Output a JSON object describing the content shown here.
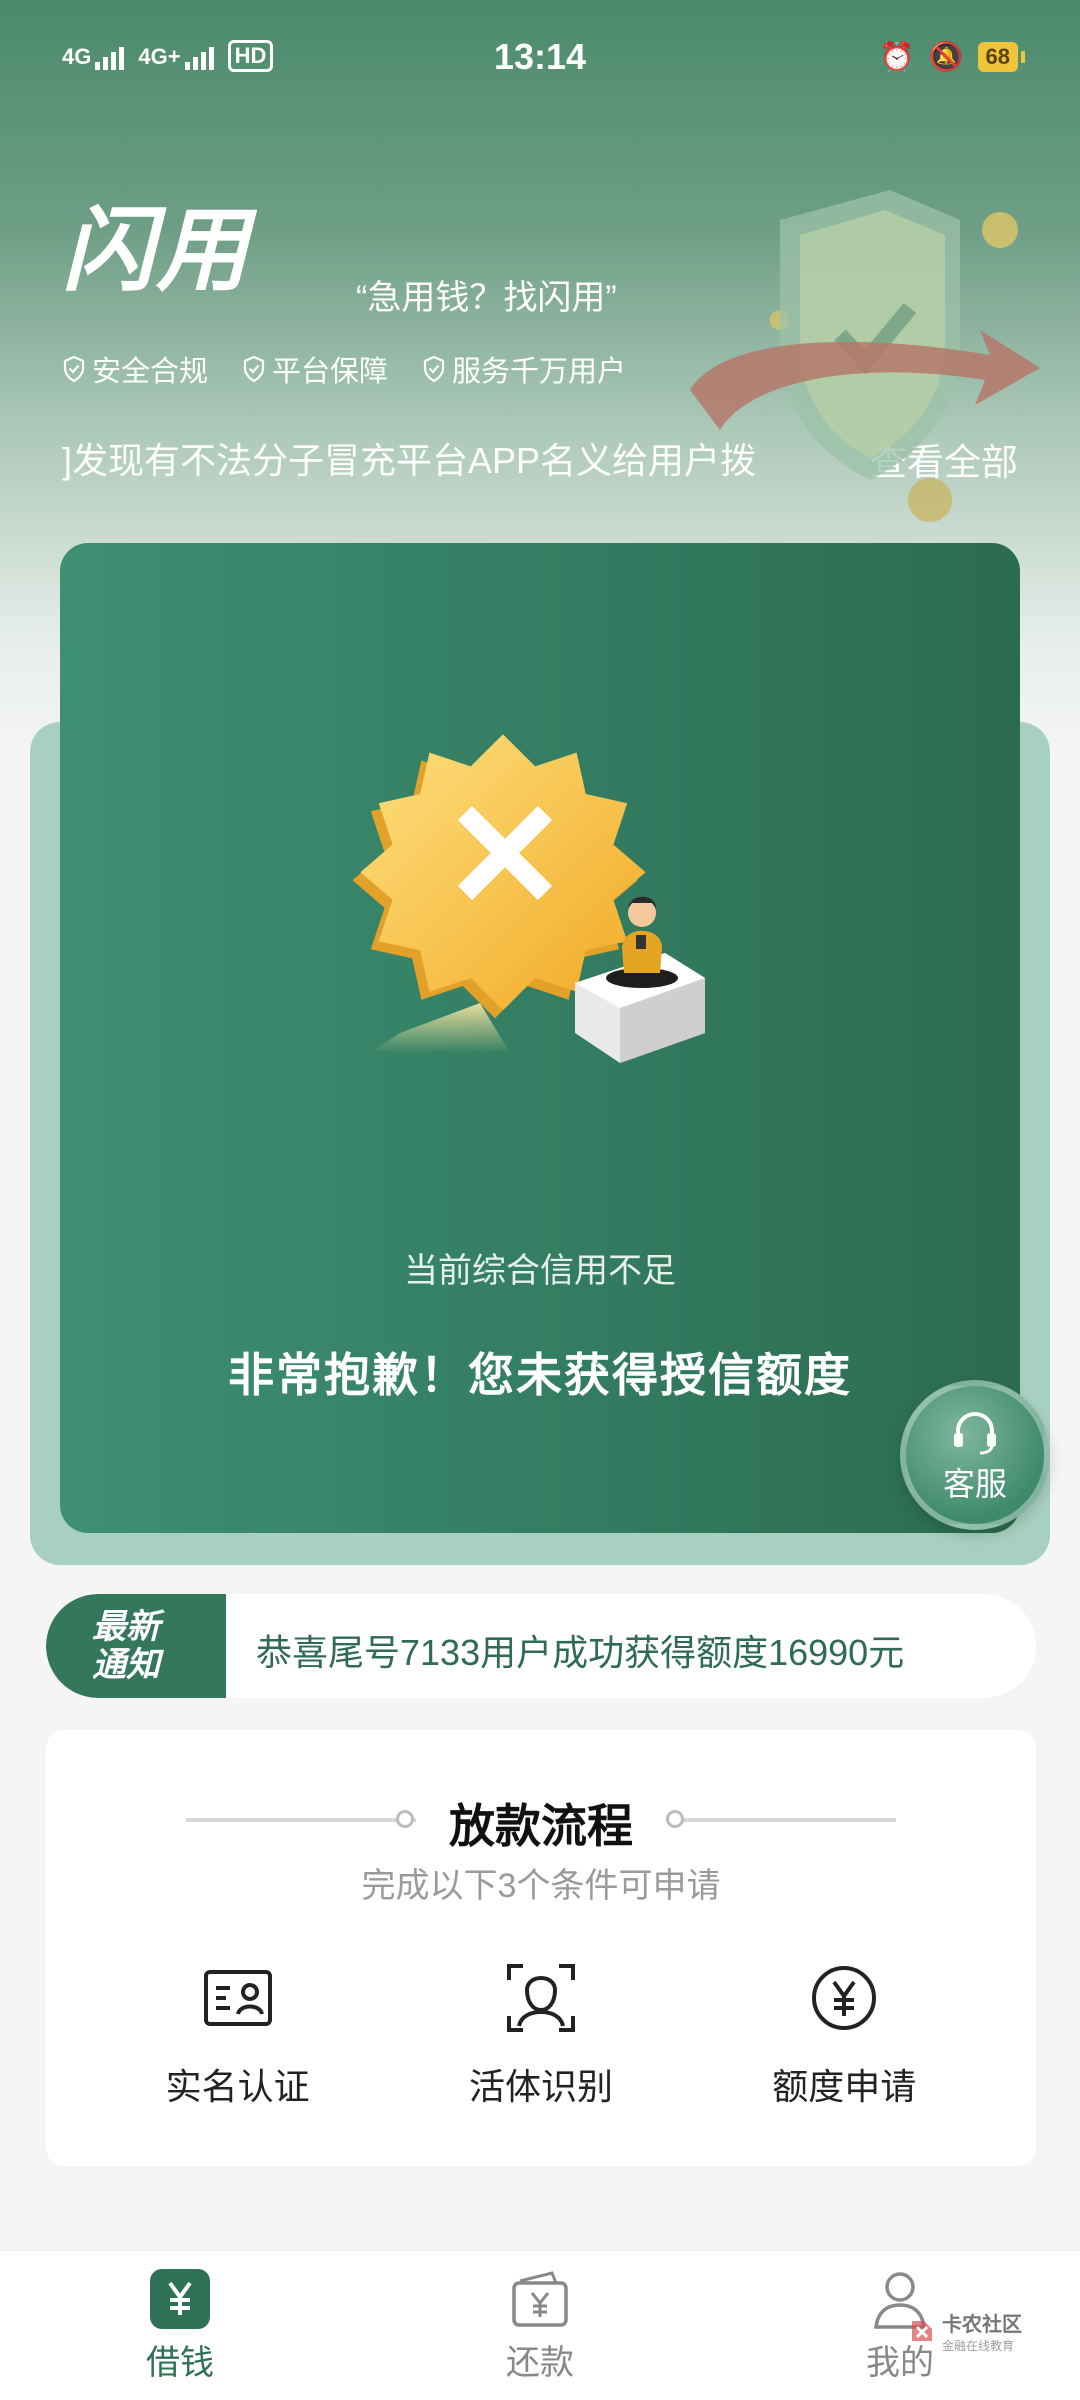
{
  "status_bar": {
    "network1": "4G",
    "network2": "4G+",
    "hd": "HD",
    "time": "13:14",
    "battery": "68"
  },
  "header": {
    "brand": "闪用",
    "slogan": "“急用钱？找闪用”",
    "badges": [
      "安全合规",
      "平台保障",
      "服务千万用户"
    ],
    "notice": "]发现有不法分子冒充平台APP名义给用户拨",
    "view_all": "查看全部"
  },
  "result_card": {
    "subtitle": "当前综合信用不足",
    "title": "非常抱歉！您未获得授信额度"
  },
  "customer_service": {
    "label": "客服"
  },
  "latest_notice": {
    "tag_line1": "最新",
    "tag_line2": "通知",
    "text": "恭喜尾号7133用户成功获得额度16990元"
  },
  "process": {
    "title": "放款流程",
    "subtitle": "完成以下3个条件可申请",
    "steps": [
      {
        "label": "实名认证",
        "icon": "id-card-icon"
      },
      {
        "label": "活体识别",
        "icon": "face-scan-icon"
      },
      {
        "label": "额度申请",
        "icon": "yuan-circle-icon"
      }
    ]
  },
  "bottom_nav": {
    "items": [
      {
        "label": "借钱",
        "icon": "yuan-square-icon",
        "active": true
      },
      {
        "label": "还款",
        "icon": "wallet-icon",
        "active": false
      },
      {
        "label": "我的",
        "icon": "user-icon",
        "active": false
      }
    ]
  },
  "watermark": {
    "main": "卡农社区",
    "sub": "金融在线教育"
  },
  "colors": {
    "brand_green": "#35775c",
    "card_green": "#347e63",
    "badge_yellow": "#f3b93a"
  }
}
